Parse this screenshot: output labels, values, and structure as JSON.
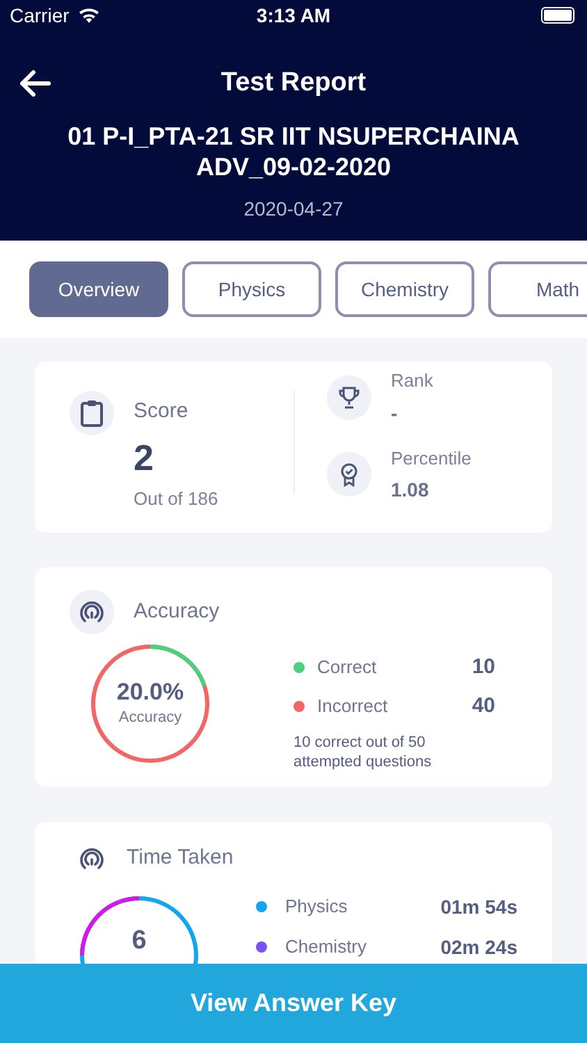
{
  "status_bar": {
    "carrier": "Carrier",
    "time": "3:13 AM"
  },
  "header": {
    "title": "Test Report",
    "test_name": "01 P-I_PTA-21 SR IIT NSUPERCHAINA ADV_09-02-2020",
    "date": "2020-04-27"
  },
  "tabs": [
    {
      "label": "Overview",
      "selected": true
    },
    {
      "label": "Physics",
      "selected": false
    },
    {
      "label": "Chemistry",
      "selected": false
    },
    {
      "label": "Math",
      "selected": false
    }
  ],
  "score_card": {
    "score_label": "Score",
    "score": "2",
    "out_of": "Out of 186",
    "rank_label": "Rank",
    "rank": "-",
    "percentile_label": "Percentile",
    "percentile": "1.08"
  },
  "accuracy_card": {
    "title": "Accuracy",
    "center_value": "20.0%",
    "center_label": "Accuracy",
    "legend": [
      {
        "label": "Correct",
        "value": "10",
        "color": "#4cd07d"
      },
      {
        "label": "Incorrect",
        "value": "40",
        "color": "#f26666"
      }
    ],
    "summary": "10 correct out of 50 attempted questions"
  },
  "time_card": {
    "title": "Time Taken",
    "center_value": "6",
    "legend": [
      {
        "label": "Physics",
        "value": "01m 54s",
        "color": "#11a6ee"
      },
      {
        "label": "Chemistry",
        "value": "02m 24s",
        "color": "#7b52f0"
      }
    ]
  },
  "footer_button": "View Answer Key"
}
